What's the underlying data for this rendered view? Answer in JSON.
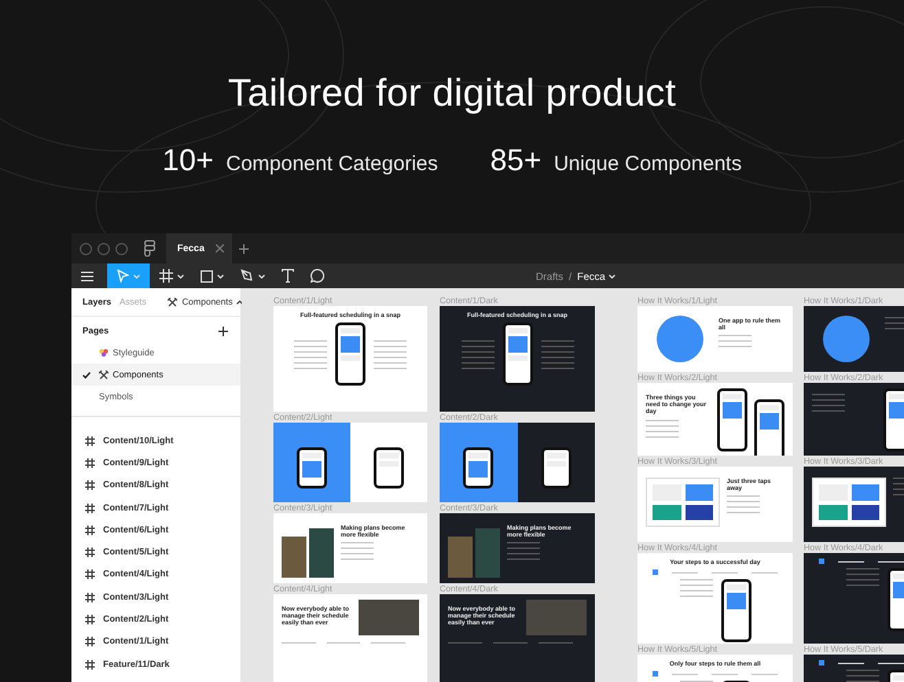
{
  "hero": {
    "title": "Tailored for digital product",
    "stats": [
      {
        "value": "10+",
        "label": "Component Categories"
      },
      {
        "value": "85+",
        "label": "Unique Components"
      }
    ]
  },
  "window": {
    "tab": {
      "title": "Fecca"
    },
    "tools": [
      {
        "kind": "move",
        "selected": true,
        "menu": true
      },
      {
        "kind": "frame",
        "selected": false,
        "menu": true
      },
      {
        "kind": "shape",
        "selected": false,
        "menu": true
      },
      {
        "kind": "pen",
        "selected": false,
        "menu": true
      },
      {
        "kind": "text",
        "selected": false,
        "menu": false
      },
      {
        "kind": "comment",
        "selected": false,
        "menu": false
      }
    ],
    "breadcrumb": {
      "parent": "Drafts",
      "separator": "/",
      "current": "Fecca"
    }
  },
  "sidebar": {
    "tabs": [
      {
        "label": "Layers",
        "selected": true
      },
      {
        "label": "Assets",
        "selected": false
      }
    ],
    "page_menu": "Components",
    "pages_heading": "Pages",
    "pages": [
      {
        "label": "Styleguide",
        "selected": false
      },
      {
        "label": "Components",
        "selected": true
      },
      {
        "label": "Symbols",
        "selected": false
      }
    ],
    "layers": [
      "Content/10/Light",
      "Content/9/Light",
      "Content/8/Light",
      "Content/7/Light",
      "Content/6/Light",
      "Content/5/Light",
      "Content/4/Light",
      "Content/3/Light",
      "Content/2/Light",
      "Content/1/Light",
      "Feature/11/Dark"
    ]
  },
  "canvas": {
    "columns": [
      {
        "frames": [
          {
            "label": "Content/1/Light",
            "dark": false,
            "kind": "phone",
            "headline": "Full-featured scheduling in a snap"
          },
          {
            "label": "Content/2/Light",
            "dark": false,
            "kind": "split"
          },
          {
            "label": "Content/3/Light",
            "dark": false,
            "kind": "duo",
            "headline": "Making plans become more flexible"
          },
          {
            "label": "Content/4/Light",
            "dark": false,
            "kind": "photo",
            "headline": "Now everybody able to manage their schedule easily than ever"
          }
        ]
      },
      {
        "frames": [
          {
            "label": "Content/1/Dark",
            "dark": true,
            "kind": "phone",
            "headline": "Full-featured scheduling in a snap"
          },
          {
            "label": "Content/2/Dark",
            "dark": true,
            "kind": "split"
          },
          {
            "label": "Content/3/Dark",
            "dark": true,
            "kind": "duo",
            "headline": "Making plans become more flexible"
          },
          {
            "label": "Content/4/Dark",
            "dark": true,
            "kind": "photo",
            "headline": "Now everybody able to manage their schedule easily than ever"
          }
        ]
      },
      {
        "frames": [
          {
            "label": "How It Works/1/Light",
            "dark": false,
            "kind": "avatar",
            "headline": "One app to rule them all"
          },
          {
            "label": "How It Works/2/Light",
            "dark": false,
            "kind": "phones",
            "headline": "Three things you need to change your day"
          },
          {
            "label": "How It Works/3/Light",
            "dark": false,
            "kind": "calendar",
            "headline": "Just three taps away"
          },
          {
            "label": "How It Works/4/Light",
            "dark": false,
            "kind": "steps",
            "headline": "Your steps to a successful day"
          },
          {
            "label": "How It Works/5/Light",
            "dark": false,
            "kind": "steps",
            "headline": "Only four steps to rule them all"
          }
        ]
      },
      {
        "frames": [
          {
            "label": "How It Works/1/Dark",
            "dark": true,
            "kind": "avatar"
          },
          {
            "label": "How It Works/2/Dark",
            "dark": true,
            "kind": "phones"
          },
          {
            "label": "How It Works/3/Dark",
            "dark": true,
            "kind": "calendar"
          },
          {
            "label": "How It Works/4/Dark",
            "dark": true,
            "kind": "steps"
          },
          {
            "label": "How It Works/5/Dark",
            "dark": true,
            "kind": "steps"
          }
        ]
      }
    ]
  }
}
